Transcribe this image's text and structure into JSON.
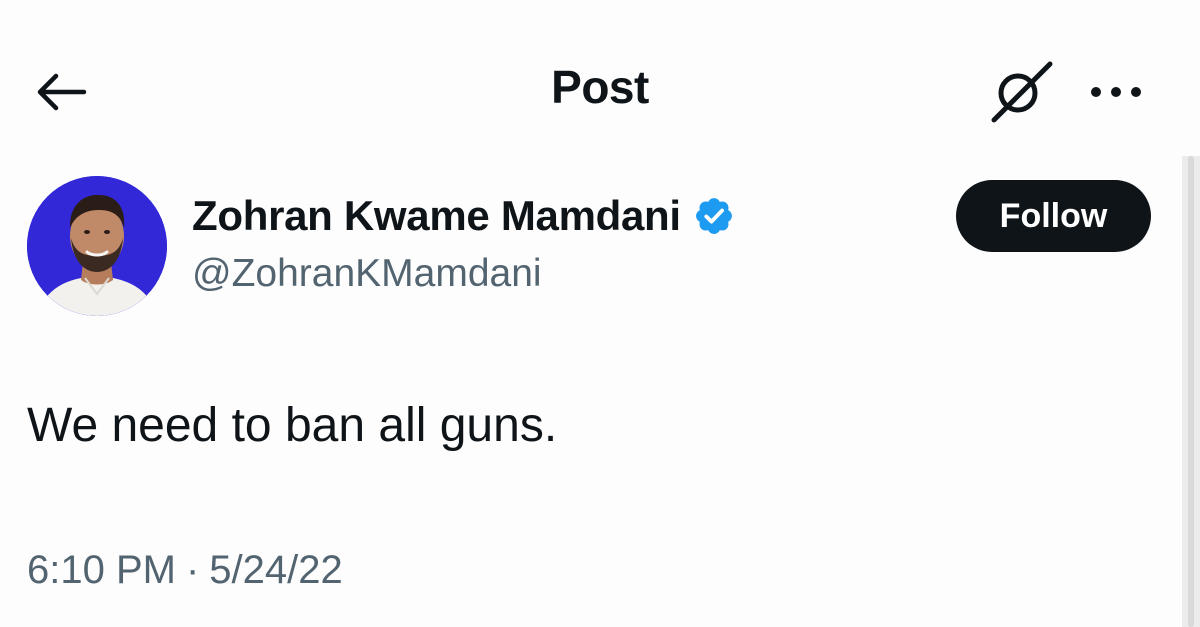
{
  "header": {
    "back_icon": "arrow-left-icon",
    "title": "Post",
    "grok_icon": "grok-icon",
    "more_icon": "more-horizontal-icon"
  },
  "author": {
    "display_name": "Zohran Kwame Mamdani",
    "verified_icon": "verified-badge-icon",
    "handle": "@ZohranKMamdani",
    "avatar_background": "#3228d8"
  },
  "follow": {
    "label": "Follow"
  },
  "post": {
    "text": "We need to ban all guns.",
    "time": "6:10 PM",
    "separator": "·",
    "date": "5/24/22"
  },
  "colors": {
    "text_primary": "#0f1419",
    "text_secondary": "#536471",
    "verified_blue": "#1d9bf0",
    "button_dark": "#0f1419"
  }
}
